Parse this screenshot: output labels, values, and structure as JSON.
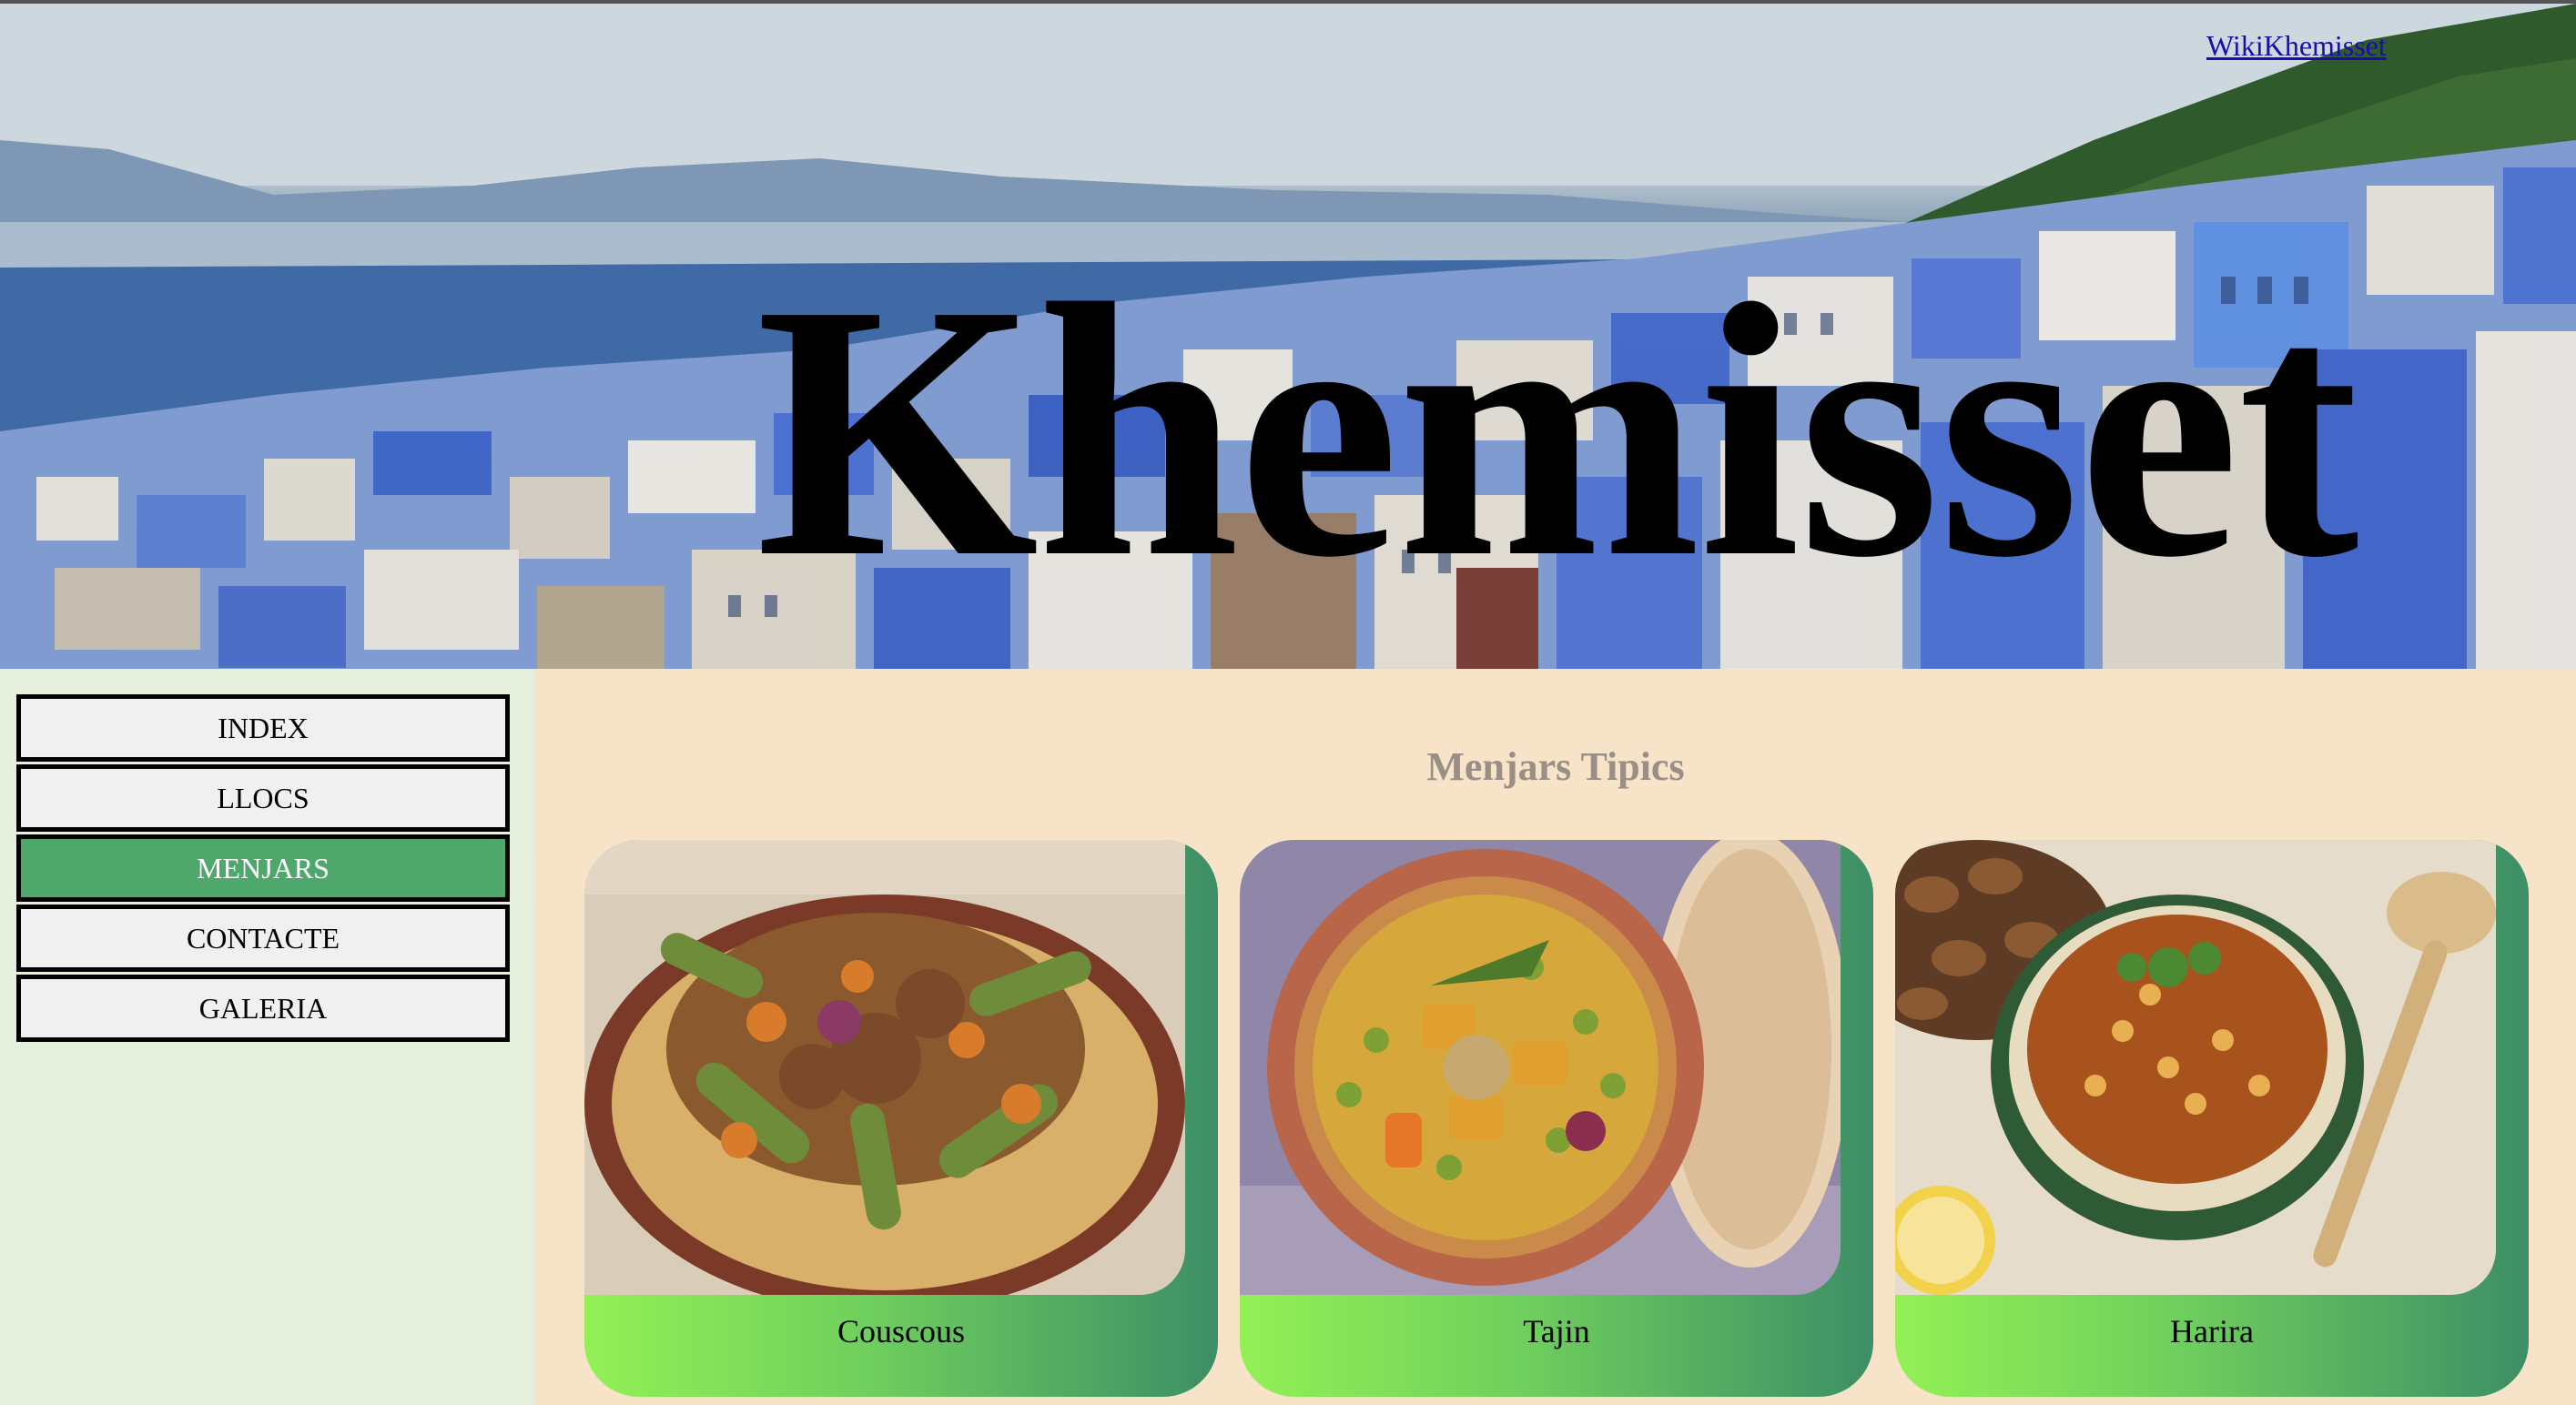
{
  "header": {
    "title": "Khemisset",
    "wiki_link": "WikiKhemisset"
  },
  "sidebar": {
    "items": [
      {
        "label": "INDEX",
        "active": false
      },
      {
        "label": "LLOCS",
        "active": false
      },
      {
        "label": "MENJARS",
        "active": true
      },
      {
        "label": "CONTACTE",
        "active": false
      },
      {
        "label": "GALERIA",
        "active": false
      }
    ]
  },
  "main": {
    "section_title": "Menjars Tipics",
    "cards": [
      {
        "caption": "Couscous",
        "image": "couscous-photo"
      },
      {
        "caption": "Tajin",
        "image": "tajin-photo"
      },
      {
        "caption": "Harira",
        "image": "harira-photo"
      }
    ]
  },
  "colors": {
    "active_nav": "#4ea86c",
    "main_bg": "#f7e3c7",
    "sidebar_bg": "#e6efdc",
    "section_title": "#9a8f86",
    "card_gradient_start": "#93f055",
    "card_gradient_end": "#3d8e66"
  }
}
